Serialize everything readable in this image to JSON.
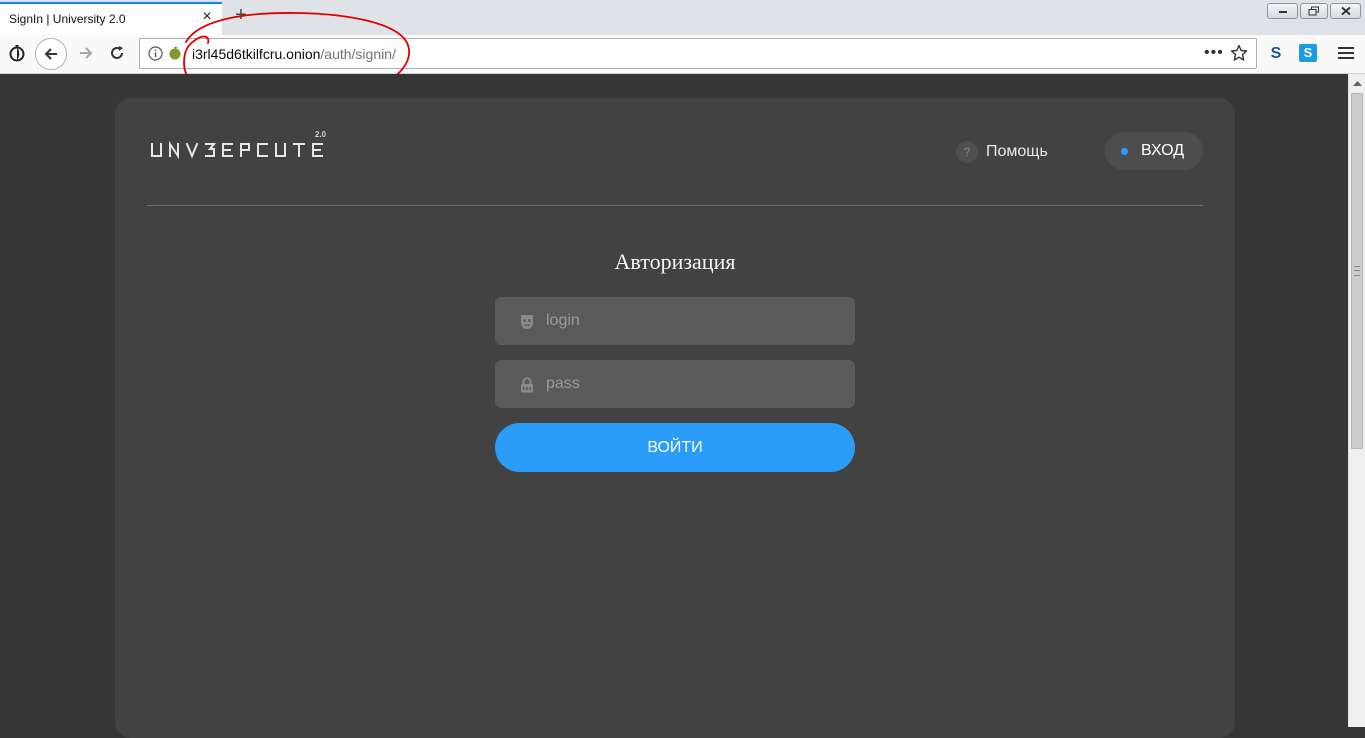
{
  "browser": {
    "tab_title": "SignIn | University 2.0",
    "url_host": "i3rl45d6tkilfcru.onion",
    "url_path": "/auth/signin/",
    "menu_dots": "•••",
    "ext_s1": "S",
    "ext_s2": "S"
  },
  "header": {
    "logo_text": "УНИВЕРСИТЕТ",
    "logo_version": "2.0",
    "help_label": "Помощь",
    "help_icon": "?",
    "login_label": "ВХОД"
  },
  "form": {
    "title": "Авторизация",
    "login_placeholder": "login",
    "password_placeholder": "pass",
    "submit_label": "ВОЙТИ"
  },
  "colors": {
    "accent": "#2b9cf8",
    "page_bg": "#363636",
    "card_bg": "#424242",
    "annotation": "#e00000"
  }
}
